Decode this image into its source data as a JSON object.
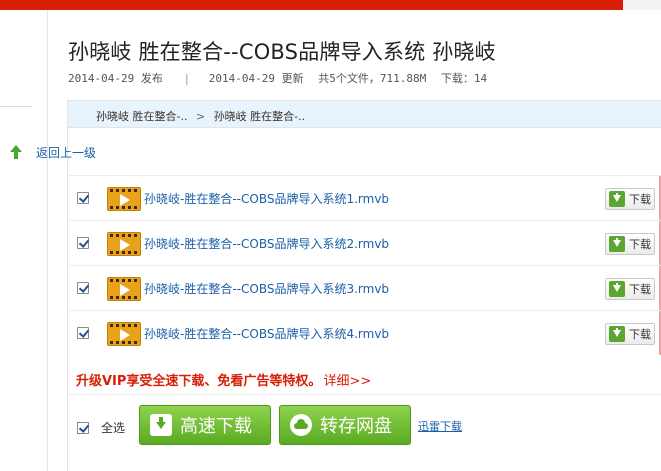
{
  "title": "孙晓岐  胜在整合--COBS品牌导入系统  孙晓岐",
  "meta": {
    "published": "2014-04-29 发布",
    "updated": "2014-04-29 更新",
    "summary": "共5个文件，711.88M",
    "downloads": "下载：14"
  },
  "breadcrumb": {
    "items": [
      "孙晓岐 胜在整合-..",
      "孙晓岐 胜在整合-.."
    ],
    "separator": ">"
  },
  "back_link": "返回上一级",
  "files": [
    {
      "name": "孙晓岐-胜在整合--COBS品牌导入系统1.rmvb",
      "download_label": "下载",
      "checked": true
    },
    {
      "name": "孙晓岐-胜在整合--COBS品牌导入系统2.rmvb",
      "download_label": "下载",
      "checked": true
    },
    {
      "name": "孙晓岐-胜在整合--COBS品牌导入系统3.rmvb",
      "download_label": "下载",
      "checked": true
    },
    {
      "name": "孙晓岐-胜在整合--COBS品牌导入系统4.rmvb",
      "download_label": "下载",
      "checked": true
    }
  ],
  "promo": {
    "text": "升级VIP享受全速下载、免看广告等特权。",
    "more": "详细>>"
  },
  "footer": {
    "select_all": "全选",
    "fast_download": "高速下载",
    "save_cloud": "转存网盘",
    "xunlei": "迅雷下载"
  },
  "colors": {
    "brand_red": "#d81e06",
    "link_blue": "#1a5fa8",
    "button_green": "#5aaa22",
    "crumb_bg": "#e9f3fb"
  },
  "icons": [
    "film-icon",
    "download-arrow-icon",
    "back-up-arrow-icon",
    "cloud-icon",
    "checkbox-icon"
  ]
}
